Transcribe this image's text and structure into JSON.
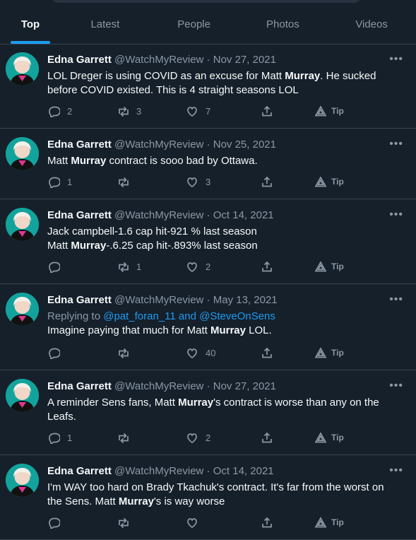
{
  "tabs": [
    "Top",
    "Latest",
    "People",
    "Photos",
    "Videos"
  ],
  "tip_label": "Tip",
  "tweets": [
    {
      "name": "Edna Garrett",
      "handle": "@WatchMyReview",
      "date": "Nov 27, 2021",
      "lines": [
        [
          {
            "t": "LOL Dreger is using COVID as an excuse for Matt "
          },
          {
            "t": "Murray",
            "b": true
          },
          {
            "t": ". He sucked"
          }
        ],
        [
          {
            "t": "before COVID existed. This is 4 straight seasons LOL"
          }
        ]
      ],
      "reply": "2",
      "retweet": "3",
      "like": "7"
    },
    {
      "name": "Edna Garrett",
      "handle": "@WatchMyReview",
      "date": "Nov 25, 2021",
      "lines": [
        [
          {
            "t": "Matt "
          },
          {
            "t": "Murray",
            "b": true
          },
          {
            "t": " contract is sooo bad by Ottawa."
          }
        ]
      ],
      "reply": "1",
      "retweet": "",
      "like": "3"
    },
    {
      "name": "Edna Garrett",
      "handle": "@WatchMyReview",
      "date": "Oct 14, 2021",
      "lines": [
        [
          {
            "t": "Jack campbell-1.6 cap hit-921 % last season"
          }
        ],
        [
          {
            "t": "Matt "
          },
          {
            "t": "Murray",
            "b": true
          },
          {
            "t": "-.6.25 cap hit-.893% last season"
          }
        ]
      ],
      "reply": "",
      "retweet": "1",
      "like": "2"
    },
    {
      "name": "Edna Garrett",
      "handle": "@WatchMyReview",
      "date": "May 13, 2021",
      "replying_prefix": "Replying to ",
      "replying_to": "@pat_foran_11 and @SteveOnSens",
      "lines": [
        [
          {
            "t": "Imagine paying that much for Matt "
          },
          {
            "t": "Murray",
            "b": true
          },
          {
            "t": " LOL."
          }
        ]
      ],
      "reply": "",
      "retweet": "",
      "like": "40"
    },
    {
      "name": "Edna Garrett",
      "handle": "@WatchMyReview",
      "date": "Nov 27, 2021",
      "lines": [
        [
          {
            "t": "A reminder Sens fans, Matt "
          },
          {
            "t": "Murray",
            "b": true
          },
          {
            "t": "'s contract is worse than any on the"
          }
        ],
        [
          {
            "t": "Leafs."
          }
        ]
      ],
      "reply": "1",
      "retweet": "",
      "like": "2"
    },
    {
      "name": "Edna Garrett",
      "handle": "@WatchMyReview",
      "date": "Oct 14, 2021",
      "lines": [
        [
          {
            "t": "I'm WAY too hard on Brady Tkachuk's contract. It's far from the worst on"
          }
        ],
        [
          {
            "t": "the Sens. Matt "
          },
          {
            "t": "Murray",
            "b": true
          },
          {
            "t": "'s is way worse"
          }
        ]
      ],
      "reply": "",
      "retweet": "",
      "like": ""
    }
  ]
}
